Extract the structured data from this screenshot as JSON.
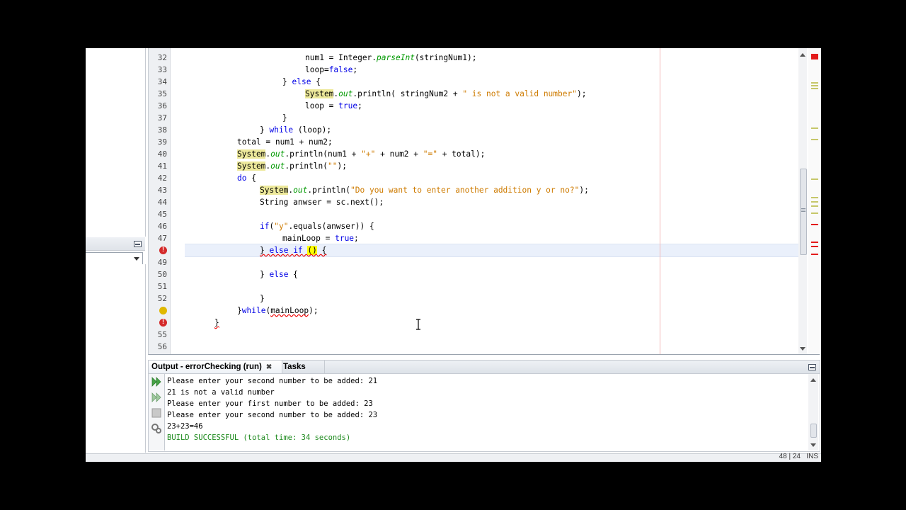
{
  "editor": {
    "lines": [
      {
        "num": "32",
        "indent": 22,
        "tokens": [
          {
            "t": "num1 = Integer."
          },
          {
            "t": "parseInt",
            "c": "it"
          },
          {
            "t": "(stringNum1);"
          }
        ]
      },
      {
        "num": "33",
        "indent": 22,
        "tokens": [
          {
            "t": "loop="
          },
          {
            "t": "false",
            "c": "kw"
          },
          {
            "t": ";"
          }
        ]
      },
      {
        "num": "34",
        "indent": 18,
        "tokens": [
          {
            "t": "} "
          },
          {
            "t": "else",
            "c": "kw"
          },
          {
            "t": " {"
          }
        ]
      },
      {
        "num": "35",
        "indent": 22,
        "tokens": [
          {
            "t": "System",
            "c": "hl"
          },
          {
            "t": "."
          },
          {
            "t": "out",
            "c": "it"
          },
          {
            "t": ".println( stringNum2 + "
          },
          {
            "t": "\" is not a valid number\"",
            "c": "str"
          },
          {
            "t": ");"
          }
        ]
      },
      {
        "num": "36",
        "indent": 22,
        "tokens": [
          {
            "t": "loop = "
          },
          {
            "t": "true",
            "c": "kw"
          },
          {
            "t": ";"
          }
        ]
      },
      {
        "num": "37",
        "indent": 18,
        "tokens": [
          {
            "t": "}"
          }
        ]
      },
      {
        "num": "38",
        "indent": 14,
        "tokens": [
          {
            "t": "} "
          },
          {
            "t": "while",
            "c": "kw"
          },
          {
            "t": " (loop);"
          }
        ]
      },
      {
        "num": "39",
        "indent": 10,
        "tokens": [
          {
            "t": "total = num1 + num2;"
          }
        ]
      },
      {
        "num": "40",
        "indent": 10,
        "tokens": [
          {
            "t": "System",
            "c": "hl"
          },
          {
            "t": "."
          },
          {
            "t": "out",
            "c": "it"
          },
          {
            "t": ".println(num1 + "
          },
          {
            "t": "\"+\"",
            "c": "str"
          },
          {
            "t": " + num2 + "
          },
          {
            "t": "\"=\"",
            "c": "str"
          },
          {
            "t": " + total);"
          }
        ]
      },
      {
        "num": "41",
        "indent": 10,
        "tokens": [
          {
            "t": "System",
            "c": "hl"
          },
          {
            "t": "."
          },
          {
            "t": "out",
            "c": "it"
          },
          {
            "t": ".println("
          },
          {
            "t": "\"\"",
            "c": "str"
          },
          {
            "t": ");"
          }
        ]
      },
      {
        "num": "42",
        "indent": 10,
        "tokens": [
          {
            "t": "do",
            "c": "kw"
          },
          {
            "t": " {"
          }
        ]
      },
      {
        "num": "43",
        "indent": 14,
        "tokens": [
          {
            "t": "System",
            "c": "hl"
          },
          {
            "t": "."
          },
          {
            "t": "out",
            "c": "it"
          },
          {
            "t": ".println("
          },
          {
            "t": "\"Do you want to enter another addition y or no?\"",
            "c": "str"
          },
          {
            "t": ");"
          }
        ]
      },
      {
        "num": "44",
        "indent": 14,
        "tokens": [
          {
            "t": "String anwser = sc.next();"
          }
        ]
      },
      {
        "num": "45",
        "indent": 0,
        "tokens": []
      },
      {
        "num": "46",
        "indent": 14,
        "tokens": [
          {
            "t": "if",
            "c": "kw"
          },
          {
            "t": "("
          },
          {
            "t": "\"y\"",
            "c": "str"
          },
          {
            "t": ".equals(anwser)) {"
          }
        ]
      },
      {
        "num": "47",
        "indent": 18,
        "tokens": [
          {
            "t": "mainLoop = "
          },
          {
            "t": "true",
            "c": "kw"
          },
          {
            "t": ";"
          }
        ]
      },
      {
        "num": "",
        "indent": 14,
        "icon": "error",
        "tokens": [
          {
            "t": "} ",
            "c": "err"
          },
          {
            "t": "else",
            "c": "kw err"
          },
          {
            "t": " ",
            "c": "err"
          },
          {
            "t": "if",
            "c": "kw err"
          },
          {
            "t": " ",
            "c": "err"
          },
          {
            "t": "()",
            "c": "par err"
          },
          {
            "t": " {",
            "c": "err"
          }
        ]
      },
      {
        "num": "49",
        "indent": 0,
        "tokens": []
      },
      {
        "num": "50",
        "indent": 14,
        "tokens": [
          {
            "t": "} "
          },
          {
            "t": "else",
            "c": "kw"
          },
          {
            "t": " {"
          }
        ]
      },
      {
        "num": "51",
        "indent": 0,
        "tokens": []
      },
      {
        "num": "52",
        "indent": 14,
        "tokens": [
          {
            "t": "}"
          }
        ]
      },
      {
        "num": "",
        "indent": 10,
        "icon": "warning",
        "tokens": [
          {
            "t": "}"
          },
          {
            "t": "while",
            "c": "kw"
          },
          {
            "t": "("
          },
          {
            "t": "mainLoop",
            "c": "err"
          },
          {
            "t": ");"
          }
        ]
      },
      {
        "num": "",
        "indent": 6,
        "icon": "error",
        "tokens": [
          {
            "t": "}",
            "c": "err"
          }
        ]
      },
      {
        "num": "55",
        "indent": 0,
        "tokens": []
      },
      {
        "num": "56",
        "indent": 0,
        "tokens": []
      }
    ]
  },
  "output": {
    "tab_output": "Output - errorChecking (run)",
    "tab_close": "✖",
    "tab_tasks": "Tasks",
    "lines": [
      {
        "text": "Please enter your second number to be added: 21"
      },
      {
        "text": "21 is not a valid number"
      },
      {
        "text": "Please enter your first number to be added: 23"
      },
      {
        "text": "Please enter your second number to be added: 23"
      },
      {
        "text": "23+23=46"
      },
      {
        "text": "BUILD SUCCESSFUL (total time: 34 seconds)",
        "c": "ok"
      }
    ]
  },
  "status": {
    "caret_position": "48 | 24",
    "insert_mode": "INS"
  },
  "colors": {
    "keyword": "#0000e6",
    "string": "#ce7b00",
    "static_field": "#009900",
    "success": "#1d8a1d",
    "error": "#d42a2a"
  }
}
